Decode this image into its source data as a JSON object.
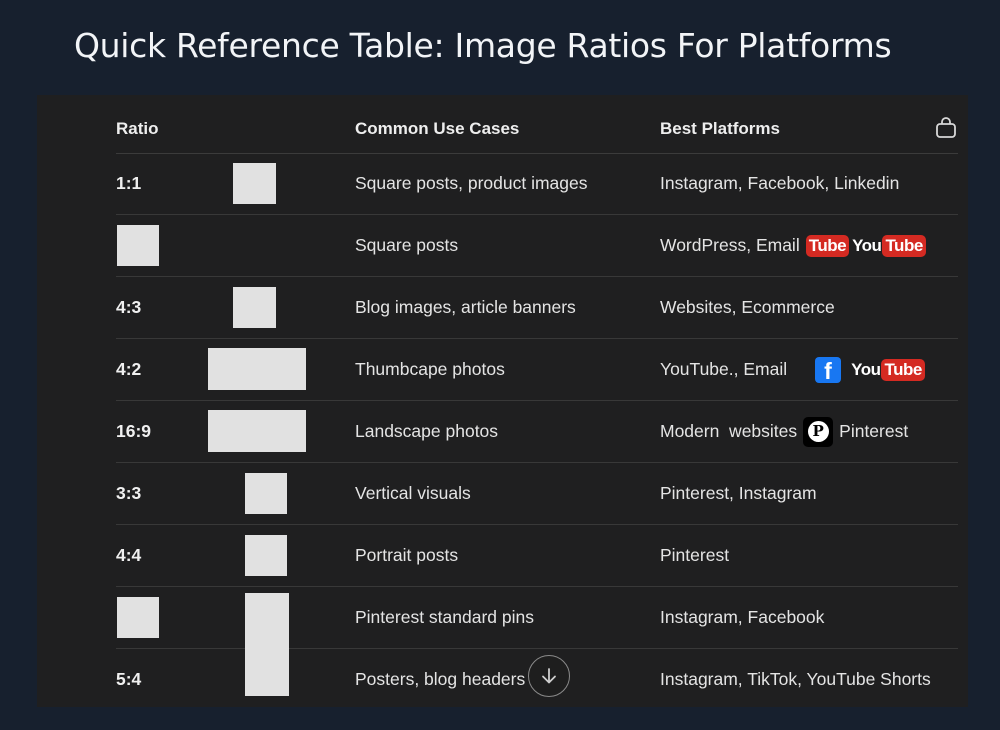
{
  "title": "Quick Reference Table: Image Ratios For Platforms",
  "table": {
    "headers": {
      "ratio": "Ratio",
      "use_cases": "Common Use Cases",
      "platforms": "Best Platforms"
    },
    "rows": [
      {
        "ratio": "1:1",
        "use": "Square posts, product images",
        "platforms": "Instagram, Facebook, Linkedin"
      },
      {
        "ratio": "",
        "use": "Square posts",
        "platforms": "WordPress, Email",
        "logos": [
          "youtube-tube",
          "youtube"
        ]
      },
      {
        "ratio": "4:3",
        "use": "Blog images, article banners",
        "platforms": "Websites, Ecommerce"
      },
      {
        "ratio": "4:2",
        "use": "Thumbcape photos",
        "platforms": "YouTube., Email",
        "logos": [
          "facebook",
          "youtube"
        ]
      },
      {
        "ratio": "16:9",
        "use": "Landscape photos",
        "platforms": "Modern  websites",
        "platforms_after": "Pinterest",
        "logos": [
          "pinterest"
        ]
      },
      {
        "ratio": "3:3",
        "use": "Vertical visuals",
        "platforms": "Pinterest, Instagram"
      },
      {
        "ratio": "4:4",
        "use": "Portrait posts",
        "platforms": "Pinterest"
      },
      {
        "ratio": "",
        "use": "Pinterest standard pins",
        "platforms": "Instagram, Facebook"
      },
      {
        "ratio": "5:4",
        "use": "Posters, blog headers",
        "platforms": "Instagram, TikTok, YouTube Shorts"
      }
    ]
  },
  "logos": {
    "youtube_you": "You",
    "youtube_tube": "Tube",
    "facebook_f": "f",
    "pinterest_p": "P"
  },
  "colors": {
    "background": "#17202e",
    "panel": "#1f1f20",
    "youtube_red": "#d42a22",
    "facebook_blue": "#1877f2"
  },
  "icons": [
    "shopping-bag-icon",
    "arrow-down-icon"
  ]
}
